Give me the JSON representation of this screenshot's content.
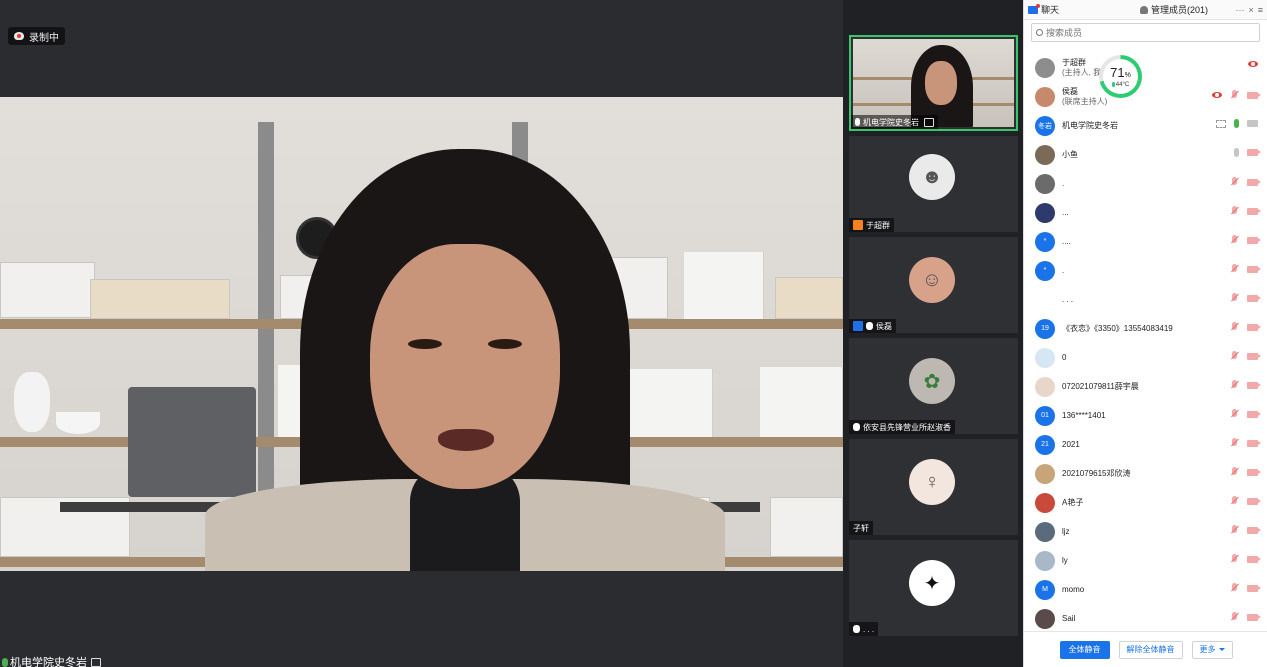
{
  "recording": {
    "label": "录制中"
  },
  "main_video": {
    "speaker_name": "机电学院史冬岩"
  },
  "gallery": [
    {
      "name": "机电学院史冬岩"
    },
    {
      "name": "于超群"
    },
    {
      "name": "侯磊"
    },
    {
      "name": "依安县先锋营业所赵淑香"
    },
    {
      "name": "子轩"
    },
    {
      "name": ". . ."
    }
  ],
  "panel": {
    "tab_chat": "聊天",
    "tab_members": "管理成员(201)",
    "more": "···",
    "close": "×",
    "menu": "≡",
    "search_placeholder": "搜索成员"
  },
  "meter": {
    "value": "71",
    "unit": "%",
    "temp": "44°C"
  },
  "members": [
    {
      "name": "于超群",
      "sub": "(主持人, 我)",
      "avatar": "",
      "icons": [
        "eye"
      ]
    },
    {
      "name": "侯磊",
      "sub": "(联席主持人)",
      "avatar": "",
      "icons": [
        "eye",
        "mic-off",
        "cam-off"
      ]
    },
    {
      "name": "机电学院史冬岩",
      "sub": "",
      "avatar": "冬岩",
      "icons": [
        "screen",
        "mic-on",
        "cam-gray"
      ]
    },
    {
      "name": "小鱼",
      "sub": "",
      "avatar": "",
      "icons": [
        "mic-gray",
        "cam-off"
      ]
    },
    {
      "name": ".",
      "sub": "",
      "avatar": "",
      "icons": [
        "mic-off",
        "cam-off"
      ]
    },
    {
      "name": "...",
      "sub": "",
      "avatar": "",
      "icons": [
        "mic-off",
        "cam-off"
      ]
    },
    {
      "name": "....",
      "sub": "",
      "avatar": "*",
      "icons": [
        "mic-off",
        "cam-off"
      ]
    },
    {
      "name": ".",
      "sub": "",
      "avatar": "*",
      "icons": [
        "mic-off",
        "cam-off"
      ]
    },
    {
      "name": ". . .",
      "sub": "",
      "avatar": "",
      "icons": [
        "mic-off",
        "cam-off"
      ]
    },
    {
      "name": "《衣恋》《3350》13554083419",
      "sub": "",
      "avatar": "19",
      "icons": [
        "mic-off",
        "cam-off"
      ]
    },
    {
      "name": "0",
      "sub": "",
      "avatar": "",
      "icons": [
        "mic-off",
        "cam-off"
      ]
    },
    {
      "name": "072021079811薛宇晨",
      "sub": "",
      "avatar": "",
      "icons": [
        "mic-off",
        "cam-off"
      ]
    },
    {
      "name": "136****1401",
      "sub": "",
      "avatar": "01",
      "icons": [
        "mic-off",
        "cam-off"
      ]
    },
    {
      "name": "2021",
      "sub": "",
      "avatar": "21",
      "icons": [
        "mic-off",
        "cam-off"
      ]
    },
    {
      "name": "2021079615邓欣涛",
      "sub": "",
      "avatar": "",
      "icons": [
        "mic-off",
        "cam-off"
      ]
    },
    {
      "name": "A艳子",
      "sub": "",
      "avatar": "",
      "icons": [
        "mic-off",
        "cam-off"
      ]
    },
    {
      "name": "ljz",
      "sub": "",
      "avatar": "",
      "icons": [
        "mic-off",
        "cam-off"
      ]
    },
    {
      "name": "ly",
      "sub": "",
      "avatar": "",
      "icons": [
        "mic-off",
        "cam-off"
      ]
    },
    {
      "name": "momo",
      "sub": "",
      "avatar": "M",
      "icons": [
        "mic-off",
        "cam-off"
      ]
    },
    {
      "name": "Sail",
      "sub": "",
      "avatar": "",
      "icons": [
        "mic-off",
        "cam-off"
      ]
    }
  ],
  "footer": {
    "mute_all": "全体静音",
    "unmute_all": "解除全体静音",
    "more": "更多"
  },
  "colors": {
    "accent": "#1a73e8",
    "active_border": "#3cc46c",
    "host": "#f5821f",
    "muted": "#e57373"
  }
}
